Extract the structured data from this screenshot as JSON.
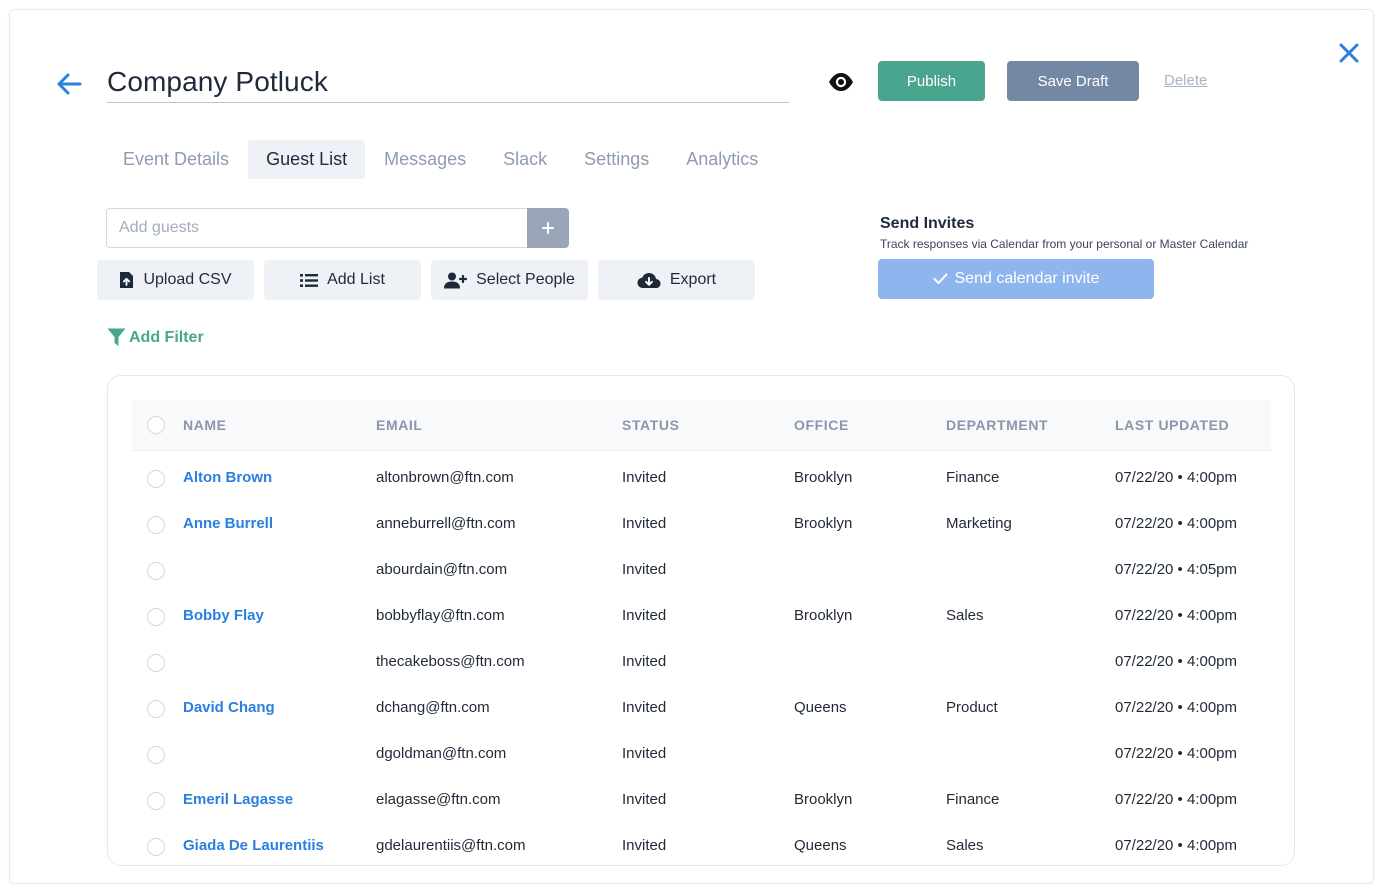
{
  "header": {
    "title": "Company Potluck",
    "publish_label": "Publish",
    "save_draft_label": "Save Draft",
    "delete_label": "Delete",
    "icons": {
      "back": "arrow-left-icon",
      "preview": "eye-icon",
      "close": "close-icon"
    }
  },
  "tabs": [
    {
      "label": "Event Details",
      "active": false
    },
    {
      "label": "Guest List",
      "active": true
    },
    {
      "label": "Messages",
      "active": false
    },
    {
      "label": "Slack",
      "active": false
    },
    {
      "label": "Settings",
      "active": false
    },
    {
      "label": "Analytics",
      "active": false
    }
  ],
  "guests": {
    "input_placeholder": "Add guests",
    "upload_csv_label": "Upload CSV",
    "add_list_label": "Add List",
    "select_people_label": "Select People",
    "export_label": "Export",
    "add_filter_label": "Add Filter"
  },
  "invites": {
    "title": "Send Invites",
    "subtitle": "Track responses via Calendar from your personal or Master Calendar",
    "button_label": "Send calendar invite"
  },
  "table": {
    "columns": [
      "NAME",
      "EMAIL",
      "STATUS",
      "OFFICE",
      "DEPARTMENT",
      "LAST UPDATED"
    ],
    "rows": [
      {
        "name": "Alton Brown",
        "email": "altonbrown@ftn.com",
        "status": "Invited",
        "office": "Brooklyn",
        "department": "Finance",
        "updated": "07/22/20 • 4:00pm"
      },
      {
        "name": "Anne Burrell",
        "email": "anneburrell@ftn.com",
        "status": "Invited",
        "office": "Brooklyn",
        "department": "Marketing",
        "updated": "07/22/20 • 4:00pm"
      },
      {
        "name": "",
        "email": "abourdain@ftn.com",
        "status": "Invited",
        "office": "",
        "department": "",
        "updated": "07/22/20 • 4:05pm"
      },
      {
        "name": "Bobby Flay",
        "email": "bobbyflay@ftn.com",
        "status": "Invited",
        "office": "Brooklyn",
        "department": "Sales",
        "updated": "07/22/20 • 4:00pm"
      },
      {
        "name": "",
        "email": "thecakeboss@ftn.com",
        "status": "Invited",
        "office": "",
        "department": "",
        "updated": "07/22/20 • 4:00pm"
      },
      {
        "name": "David Chang",
        "email": "dchang@ftn.com",
        "status": "Invited",
        "office": "Queens",
        "department": "Product",
        "updated": "07/22/20 • 4:00pm"
      },
      {
        "name": "",
        "email": "dgoldman@ftn.com",
        "status": "Invited",
        "office": "",
        "department": "",
        "updated": "07/22/20 • 4:00pm"
      },
      {
        "name": "Emeril Lagasse",
        "email": "elagasse@ftn.com",
        "status": "Invited",
        "office": "Brooklyn",
        "department": "Finance",
        "updated": "07/22/20 • 4:00pm"
      },
      {
        "name": "Giada De Laurentiis",
        "email": "gdelaurentiis@ftn.com",
        "status": "Invited",
        "office": "Queens",
        "department": "Sales",
        "updated": "07/22/20 • 4:00pm"
      }
    ]
  },
  "colors": {
    "accent_blue": "#2b7fe0",
    "publish_green": "#4aa58f",
    "draft_slate": "#7588a3",
    "invite_blue": "#8fb5ee"
  }
}
